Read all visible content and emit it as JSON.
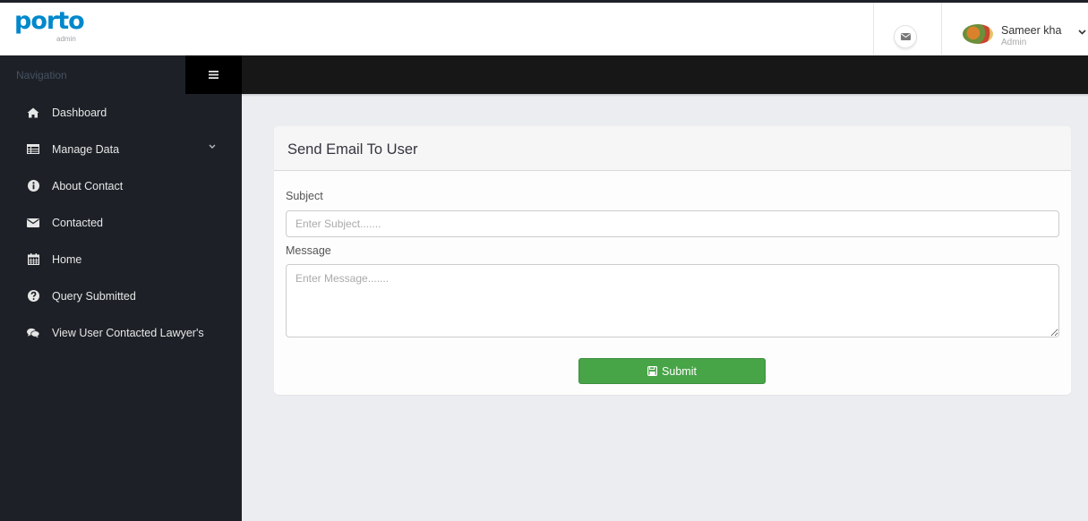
{
  "header": {
    "logo_text": "porto",
    "logo_sub": "admin",
    "user_name": "Sameer kha",
    "user_role": "Admin"
  },
  "sidebar": {
    "heading": "Navigation",
    "items": [
      {
        "label": "Dashboard",
        "icon": "home-icon"
      },
      {
        "label": "Manage Data",
        "icon": "table-icon",
        "has_submenu": true
      },
      {
        "label": "About Contact",
        "icon": "info-circle-icon"
      },
      {
        "label": "Contacted",
        "icon": "envelope-icon"
      },
      {
        "label": "Home",
        "icon": "calendar-icon"
      },
      {
        "label": "Query Submitted",
        "icon": "question-circle-icon"
      },
      {
        "label": "View User Contacted Lawyer's",
        "icon": "comments-icon"
      }
    ]
  },
  "form": {
    "title": "Send Email To User",
    "subject_label": "Subject",
    "subject_placeholder": "Enter Subject.......",
    "subject_value": "",
    "message_label": "Message",
    "message_placeholder": "Enter Message.......",
    "message_value": "",
    "submit_label": "Submit"
  },
  "colors": {
    "sidebar_bg": "#1d2127",
    "brand": "#0088cc",
    "submit_bg": "#47a447",
    "content_bg": "#ecedf0"
  }
}
